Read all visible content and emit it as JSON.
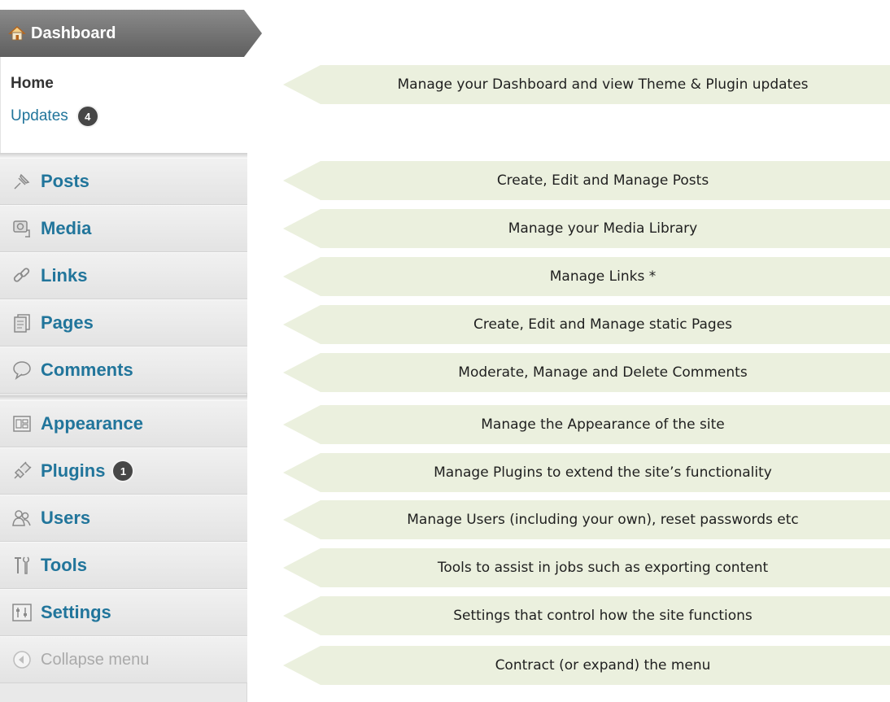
{
  "sidebar": {
    "header": {
      "label": "Dashboard",
      "icon": "home-icon"
    },
    "submenu": {
      "home": "Home",
      "updates": {
        "label": "Updates",
        "count": "4"
      }
    },
    "items": [
      {
        "label": "Posts",
        "icon": "pushpin-icon"
      },
      {
        "label": "Media",
        "icon": "media-icon"
      },
      {
        "label": "Links",
        "icon": "link-icon"
      },
      {
        "label": "Pages",
        "icon": "pages-icon"
      },
      {
        "label": "Comments",
        "icon": "comment-bubble-icon"
      },
      {
        "label": "Appearance",
        "icon": "appearance-icon"
      },
      {
        "label": "Plugins",
        "icon": "plug-icon",
        "count": "1"
      },
      {
        "label": "Users",
        "icon": "users-icon"
      },
      {
        "label": "Tools",
        "icon": "tools-icon"
      },
      {
        "label": "Settings",
        "icon": "settings-icon"
      },
      {
        "label": "Collapse menu",
        "icon": "collapse-arrow-icon"
      }
    ]
  },
  "callouts": [
    "Manage your Dashboard and view Theme & Plugin updates",
    "Create, Edit and Manage Posts",
    "Manage your Media Library",
    "Manage Links *",
    "Create, Edit and Manage static Pages",
    "Moderate, Manage and Delete Comments",
    "Manage the Appearance of the site",
    "Manage Plugins to extend the site’s functionality",
    "Manage Users (including your own), reset passwords etc",
    "Tools to assist in jobs such as exporting content",
    "Settings that control how the site functions",
    "Contract (or expand) the menu"
  ],
  "colors": {
    "menu_link": "#21759b",
    "callout_bg": "#ebf0de",
    "header_bg": "#6f6f6f"
  }
}
